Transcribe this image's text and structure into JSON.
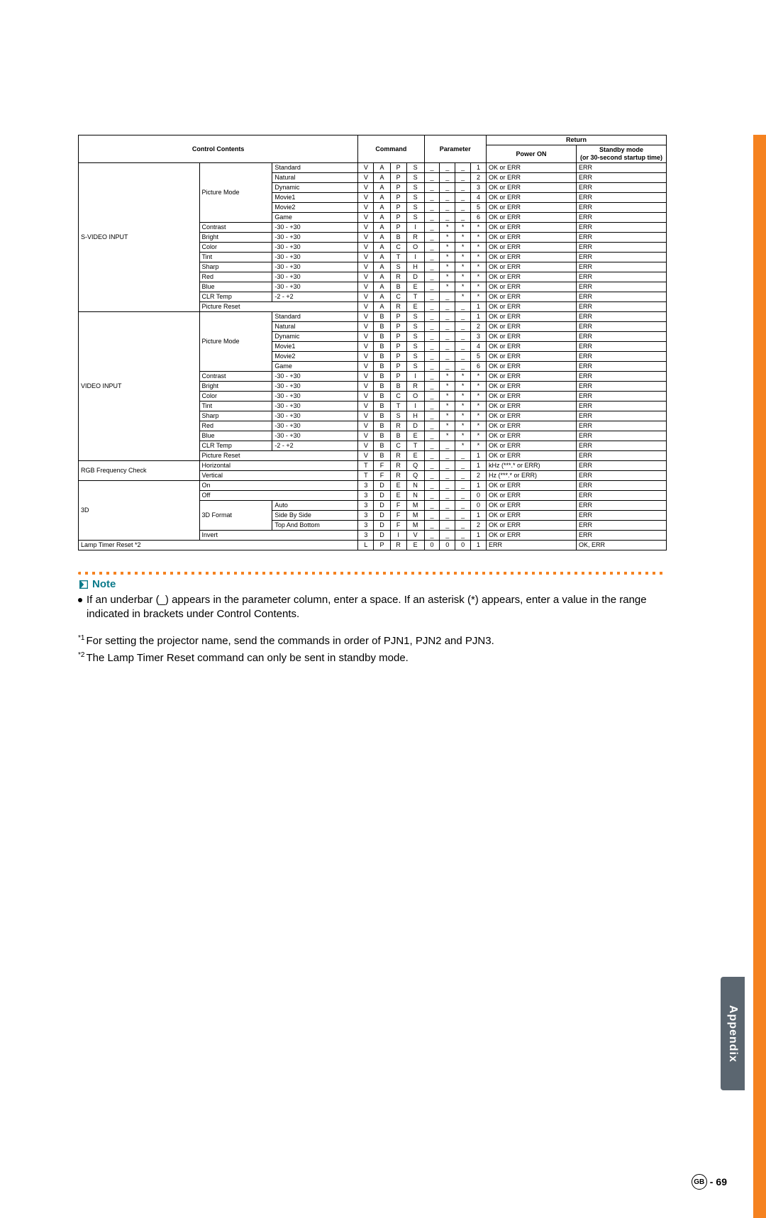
{
  "table": {
    "header": {
      "control_contents": "Control Contents",
      "command": "Command",
      "parameter": "Parameter",
      "return": "Return",
      "power_on": "Power ON",
      "standby": "Standby mode\n(or 30-second startup time)"
    },
    "groups": [
      {
        "category": "S-VIDEO INPUT",
        "subgroups": [
          {
            "label": "Picture Mode",
            "items": [
              {
                "opt": "Standard",
                "cmd": [
                  "V",
                  "A",
                  "P",
                  "S"
                ],
                "param": [
                  "_",
                  "_",
                  "_",
                  "1"
                ],
                "r1": "OK or ERR",
                "r2": "ERR"
              },
              {
                "opt": "Natural",
                "cmd": [
                  "V",
                  "A",
                  "P",
                  "S"
                ],
                "param": [
                  "_",
                  "_",
                  "_",
                  "2"
                ],
                "r1": "OK or ERR",
                "r2": "ERR"
              },
              {
                "opt": "Dynamic",
                "cmd": [
                  "V",
                  "A",
                  "P",
                  "S"
                ],
                "param": [
                  "_",
                  "_",
                  "_",
                  "3"
                ],
                "r1": "OK or ERR",
                "r2": "ERR"
              },
              {
                "opt": "Movie1",
                "cmd": [
                  "V",
                  "A",
                  "P",
                  "S"
                ],
                "param": [
                  "_",
                  "_",
                  "_",
                  "4"
                ],
                "r1": "OK or ERR",
                "r2": "ERR"
              },
              {
                "opt": "Movie2",
                "cmd": [
                  "V",
                  "A",
                  "P",
                  "S"
                ],
                "param": [
                  "_",
                  "_",
                  "_",
                  "5"
                ],
                "r1": "OK or ERR",
                "r2": "ERR"
              },
              {
                "opt": "Game",
                "cmd": [
                  "V",
                  "A",
                  "P",
                  "S"
                ],
                "param": [
                  "_",
                  "_",
                  "_",
                  "6"
                ],
                "r1": "OK or ERR",
                "r2": "ERR"
              }
            ]
          },
          {
            "label": "Contrast",
            "range": "-30 - +30",
            "cmd": [
              "V",
              "A",
              "P",
              "I"
            ],
            "param": [
              "_",
              "*",
              "*",
              "*"
            ],
            "r1": "OK or ERR",
            "r2": "ERR"
          },
          {
            "label": "Bright",
            "range": "-30 - +30",
            "cmd": [
              "V",
              "A",
              "B",
              "R"
            ],
            "param": [
              "_",
              "*",
              "*",
              "*"
            ],
            "r1": "OK or ERR",
            "r2": "ERR"
          },
          {
            "label": "Color",
            "range": "-30 - +30",
            "cmd": [
              "V",
              "A",
              "C",
              "O"
            ],
            "param": [
              "_",
              "*",
              "*",
              "*"
            ],
            "r1": "OK or ERR",
            "r2": "ERR"
          },
          {
            "label": "Tint",
            "range": "-30 - +30",
            "cmd": [
              "V",
              "A",
              "T",
              "I"
            ],
            "param": [
              "_",
              "*",
              "*",
              "*"
            ],
            "r1": "OK or ERR",
            "r2": "ERR"
          },
          {
            "label": "Sharp",
            "range": "-30 - +30",
            "cmd": [
              "V",
              "A",
              "S",
              "H"
            ],
            "param": [
              "_",
              "*",
              "*",
              "*"
            ],
            "r1": "OK or ERR",
            "r2": "ERR"
          },
          {
            "label": "Red",
            "range": "-30 - +30",
            "cmd": [
              "V",
              "A",
              "R",
              "D"
            ],
            "param": [
              "_",
              "*",
              "*",
              "*"
            ],
            "r1": "OK or ERR",
            "r2": "ERR"
          },
          {
            "label": "Blue",
            "range": "-30 - +30",
            "cmd": [
              "V",
              "A",
              "B",
              "E"
            ],
            "param": [
              "_",
              "*",
              "*",
              "*"
            ],
            "r1": "OK or ERR",
            "r2": "ERR"
          },
          {
            "label": "CLR Temp",
            "range": "-2 - +2",
            "cmd": [
              "V",
              "A",
              "C",
              "T"
            ],
            "param": [
              "_",
              "_",
              "*",
              "*"
            ],
            "r1": "OK or ERR",
            "r2": "ERR"
          },
          {
            "label": "Picture Reset",
            "range": "",
            "cmd": [
              "V",
              "A",
              "R",
              "E"
            ],
            "param": [
              "_",
              "_",
              "_",
              "1"
            ],
            "r1": "OK or ERR",
            "r2": "ERR"
          }
        ]
      },
      {
        "category": "VIDEO INPUT",
        "subgroups": [
          {
            "label": "Picture Mode",
            "items": [
              {
                "opt": "Standard",
                "cmd": [
                  "V",
                  "B",
                  "P",
                  "S"
                ],
                "param": [
                  "_",
                  "_",
                  "_",
                  "1"
                ],
                "r1": "OK or ERR",
                "r2": "ERR"
              },
              {
                "opt": "Natural",
                "cmd": [
                  "V",
                  "B",
                  "P",
                  "S"
                ],
                "param": [
                  "_",
                  "_",
                  "_",
                  "2"
                ],
                "r1": "OK or ERR",
                "r2": "ERR"
              },
              {
                "opt": "Dynamic",
                "cmd": [
                  "V",
                  "B",
                  "P",
                  "S"
                ],
                "param": [
                  "_",
                  "_",
                  "_",
                  "3"
                ],
                "r1": "OK or ERR",
                "r2": "ERR"
              },
              {
                "opt": "Movie1",
                "cmd": [
                  "V",
                  "B",
                  "P",
                  "S"
                ],
                "param": [
                  "_",
                  "_",
                  "_",
                  "4"
                ],
                "r1": "OK or ERR",
                "r2": "ERR"
              },
              {
                "opt": "Movie2",
                "cmd": [
                  "V",
                  "B",
                  "P",
                  "S"
                ],
                "param": [
                  "_",
                  "_",
                  "_",
                  "5"
                ],
                "r1": "OK or ERR",
                "r2": "ERR"
              },
              {
                "opt": "Game",
                "cmd": [
                  "V",
                  "B",
                  "P",
                  "S"
                ],
                "param": [
                  "_",
                  "_",
                  "_",
                  "6"
                ],
                "r1": "OK or ERR",
                "r2": "ERR"
              }
            ]
          },
          {
            "label": "Contrast",
            "range": "-30 - +30",
            "cmd": [
              "V",
              "B",
              "P",
              "I"
            ],
            "param": [
              "_",
              "*",
              "*",
              "*"
            ],
            "r1": "OK or ERR",
            "r2": "ERR"
          },
          {
            "label": "Bright",
            "range": "-30 - +30",
            "cmd": [
              "V",
              "B",
              "B",
              "R"
            ],
            "param": [
              "_",
              "*",
              "*",
              "*"
            ],
            "r1": "OK or ERR",
            "r2": "ERR"
          },
          {
            "label": "Color",
            "range": "-30 - +30",
            "cmd": [
              "V",
              "B",
              "C",
              "O"
            ],
            "param": [
              "_",
              "*",
              "*",
              "*"
            ],
            "r1": "OK or ERR",
            "r2": "ERR"
          },
          {
            "label": "Tint",
            "range": "-30 - +30",
            "cmd": [
              "V",
              "B",
              "T",
              "I"
            ],
            "param": [
              "_",
              "*",
              "*",
              "*"
            ],
            "r1": "OK or ERR",
            "r2": "ERR"
          },
          {
            "label": "Sharp",
            "range": "-30 - +30",
            "cmd": [
              "V",
              "B",
              "S",
              "H"
            ],
            "param": [
              "_",
              "*",
              "*",
              "*"
            ],
            "r1": "OK or ERR",
            "r2": "ERR"
          },
          {
            "label": "Red",
            "range": "-30 - +30",
            "cmd": [
              "V",
              "B",
              "R",
              "D"
            ],
            "param": [
              "_",
              "*",
              "*",
              "*"
            ],
            "r1": "OK or ERR",
            "r2": "ERR"
          },
          {
            "label": "Blue",
            "range": "-30 - +30",
            "cmd": [
              "V",
              "B",
              "B",
              "E"
            ],
            "param": [
              "_",
              "*",
              "*",
              "*"
            ],
            "r1": "OK or ERR",
            "r2": "ERR"
          },
          {
            "label": "CLR Temp",
            "range": "-2 - +2",
            "cmd": [
              "V",
              "B",
              "C",
              "T"
            ],
            "param": [
              "_",
              "_",
              "*",
              "*"
            ],
            "r1": "OK or ERR",
            "r2": "ERR"
          },
          {
            "label": "Picture Reset",
            "range": "",
            "cmd": [
              "V",
              "B",
              "R",
              "E"
            ],
            "param": [
              "_",
              "_",
              "_",
              "1"
            ],
            "r1": "OK or ERR",
            "r2": "ERR"
          }
        ]
      },
      {
        "category": "RGB Frequency Check",
        "subgroups": [
          {
            "label": "Horizontal",
            "range": "",
            "cmd": [
              "T",
              "F",
              "R",
              "Q"
            ],
            "param": [
              "_",
              "_",
              "_",
              "1"
            ],
            "r1": "kHz (***.* or ERR)",
            "r2": "ERR"
          },
          {
            "label": "Vertical",
            "range": "",
            "cmd": [
              "T",
              "F",
              "R",
              "Q"
            ],
            "param": [
              "_",
              "_",
              "_",
              "2"
            ],
            "r1": "Hz (***.* or ERR)",
            "r2": "ERR"
          }
        ]
      },
      {
        "category": "3D",
        "subgroups": [
          {
            "label": "On",
            "range": "",
            "cmd": [
              "3",
              "D",
              "E",
              "N"
            ],
            "param": [
              "_",
              "_",
              "_",
              "1"
            ],
            "r1": "OK or ERR",
            "r2": "ERR"
          },
          {
            "label": "Off",
            "range": "",
            "cmd": [
              "3",
              "D",
              "E",
              "N"
            ],
            "param": [
              "_",
              "_",
              "_",
              "0"
            ],
            "r1": "OK or ERR",
            "r2": "ERR"
          },
          {
            "label": "3D Format",
            "items": [
              {
                "opt": "Auto",
                "cmd": [
                  "3",
                  "D",
                  "F",
                  "M"
                ],
                "param": [
                  "_",
                  "_",
                  "_",
                  "0"
                ],
                "r1": "OK or ERR",
                "r2": "ERR"
              },
              {
                "opt": "Side By Side",
                "cmd": [
                  "3",
                  "D",
                  "F",
                  "M"
                ],
                "param": [
                  "_",
                  "_",
                  "_",
                  "1"
                ],
                "r1": "OK or ERR",
                "r2": "ERR"
              },
              {
                "opt": "Top And Bottom",
                "cmd": [
                  "3",
                  "D",
                  "F",
                  "M"
                ],
                "param": [
                  "_",
                  "_",
                  "_",
                  "2"
                ],
                "r1": "OK or ERR",
                "r2": "ERR"
              }
            ]
          },
          {
            "label": "Invert",
            "range": "",
            "cmd": [
              "3",
              "D",
              "I",
              "V"
            ],
            "param": [
              "_",
              "_",
              "_",
              "1"
            ],
            "r1": "OK or ERR",
            "r2": "ERR"
          }
        ]
      },
      {
        "category": "Lamp Timer Reset *2",
        "fullrow": true,
        "cmd": [
          "L",
          "P",
          "R",
          "E"
        ],
        "param": [
          "0",
          "0",
          "0",
          "1"
        ],
        "r1": "ERR",
        "r2": "OK, ERR"
      }
    ]
  },
  "note": {
    "heading": "Note",
    "text": "If an underbar (_) appears in the parameter column, enter a space. If an asterisk (*) appears, enter a value in the range indicated in brackets under Control Contents."
  },
  "footnotes": {
    "f1_sup": "*1",
    "f1": "For setting the projector name, send the commands in order of PJN1, PJN2 and PJN3.",
    "f2_sup": "*2",
    "f2": "The Lamp Timer Reset command can only be sent in standby mode."
  },
  "sidebar": "Appendix",
  "footer": {
    "gb": "GB",
    "dash": "-",
    "num": "69"
  }
}
